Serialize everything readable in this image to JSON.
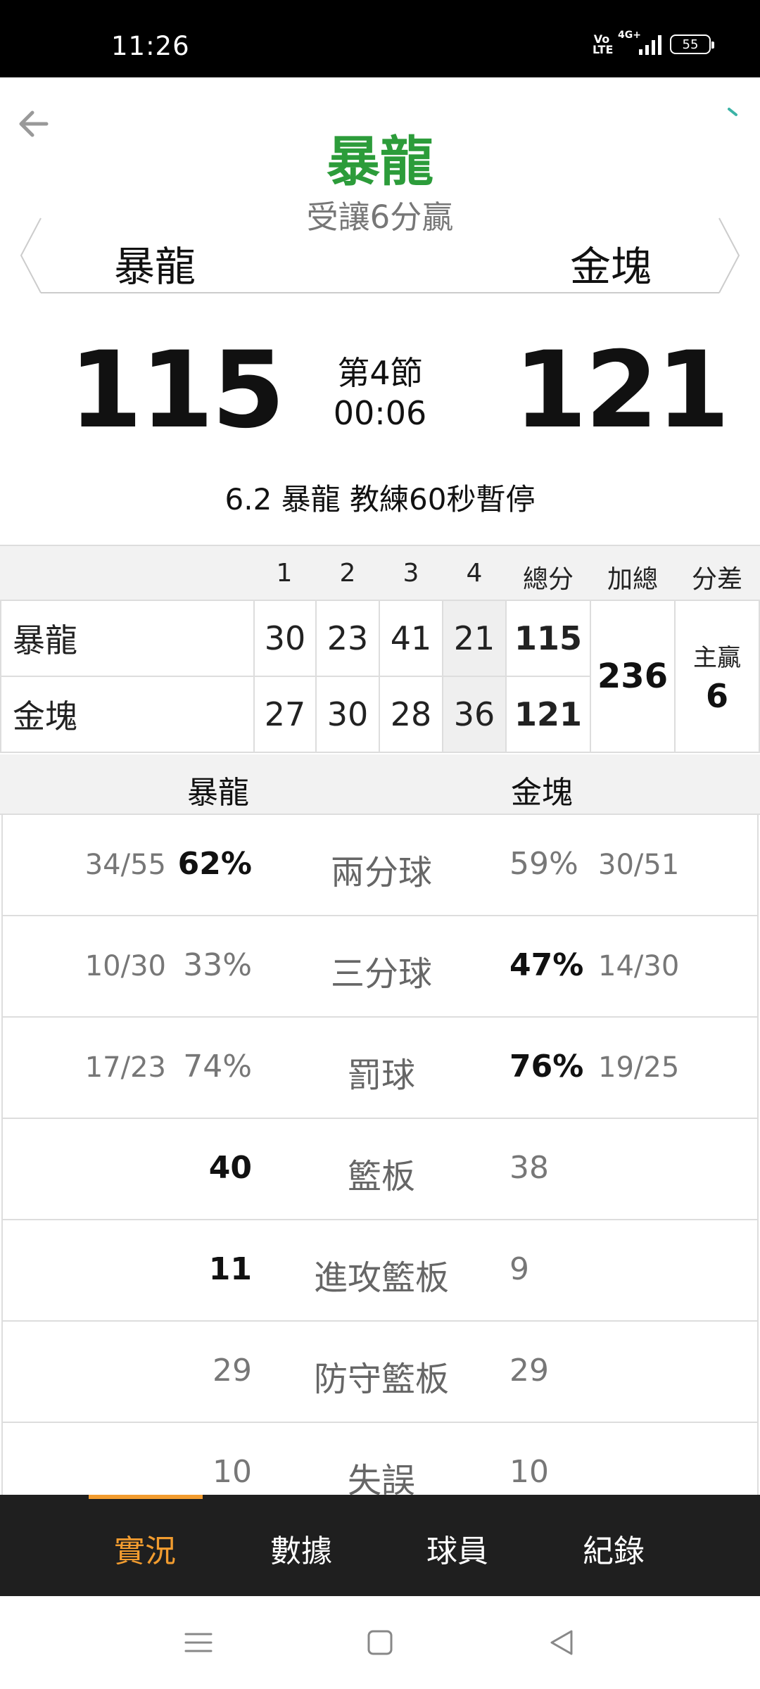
{
  "status_bar": {
    "time": "11:26",
    "volte": "Vo LTE",
    "network": "4G+",
    "battery": "55"
  },
  "header": {
    "title": "暴龍",
    "subtitle": "受讓6分贏",
    "team_left": "暴龍",
    "team_right": "金塊"
  },
  "score": {
    "home": "115",
    "away": "121",
    "period": "第4節",
    "clock": "00:06",
    "event": "6.2 暴龍  教練60秒暫停"
  },
  "quarter_table": {
    "headers": [
      "1",
      "2",
      "3",
      "4",
      "總分",
      "加總",
      "分差"
    ],
    "rows": [
      {
        "team": "暴龍",
        "q": [
          "30",
          "23",
          "41",
          "21"
        ],
        "total": "115"
      },
      {
        "team": "金塊",
        "q": [
          "27",
          "30",
          "28",
          "36"
        ],
        "total": "121"
      }
    ],
    "sum": "236",
    "diff_label": "主贏",
    "diff_value": "6"
  },
  "comparison": {
    "home": "暴龍",
    "away": "金塊",
    "stats": [
      {
        "label": "兩分球",
        "home_made": "34/55",
        "home": "62%",
        "away": "59%",
        "away_made": "30/51",
        "lead": "home"
      },
      {
        "label": "三分球",
        "home_made": "10/30",
        "home": "33%",
        "away": "47%",
        "away_made": "14/30",
        "lead": "away"
      },
      {
        "label": "罰球",
        "home_made": "17/23",
        "home": "74%",
        "away": "76%",
        "away_made": "19/25",
        "lead": "away"
      },
      {
        "label": "籃板",
        "home_made": "",
        "home": "40",
        "away": "38",
        "away_made": "",
        "lead": "home"
      },
      {
        "label": "進攻籃板",
        "home_made": "",
        "home": "11",
        "away": "9",
        "away_made": "",
        "lead": "home"
      },
      {
        "label": "防守籃板",
        "home_made": "",
        "home": "29",
        "away": "29",
        "away_made": "",
        "lead": "none"
      },
      {
        "label": "失誤",
        "home_made": "",
        "home": "10",
        "away": "10",
        "away_made": "",
        "lead": "none"
      }
    ]
  },
  "bottom_nav": {
    "items": [
      "實況",
      "數據",
      "球員",
      "紀錄"
    ],
    "active": "實況",
    "accent": "#f29c2f"
  },
  "colors": {
    "title_green": "#2c9c3a",
    "nav_bg": "#1f1f1f"
  }
}
